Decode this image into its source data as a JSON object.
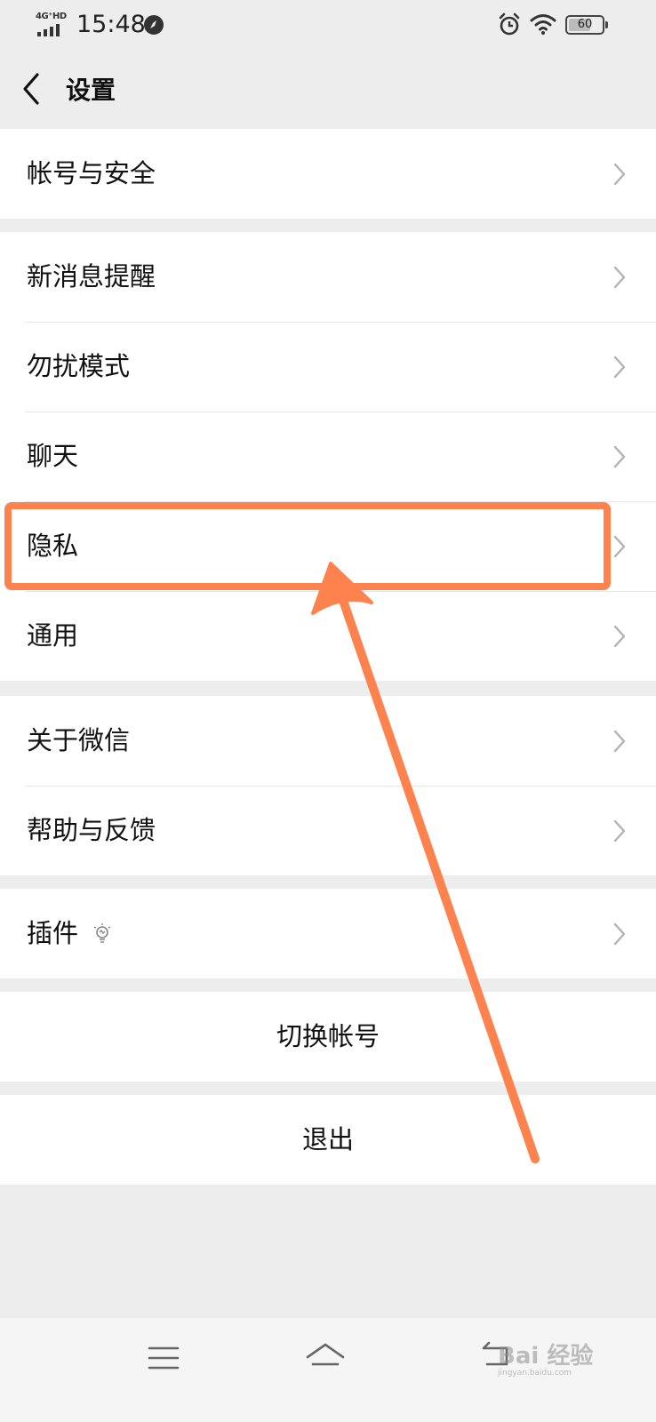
{
  "status_bar": {
    "network": "4G⁺HD",
    "time": "15:48",
    "battery": "60",
    "battery_level": 0.6
  },
  "header": {
    "back_icon": "chevron-left-icon",
    "title": "设置"
  },
  "groups": [
    {
      "items": [
        {
          "label": "帐号与安全"
        }
      ]
    },
    {
      "items": [
        {
          "label": "新消息提醒"
        },
        {
          "label": "勿扰模式"
        },
        {
          "label": "聊天"
        },
        {
          "label": "隐私"
        },
        {
          "label": "通用"
        }
      ]
    },
    {
      "items": [
        {
          "label": "关于微信"
        },
        {
          "label": "帮助与反馈"
        }
      ]
    },
    {
      "items": [
        {
          "label": "插件",
          "icon": "bulb-icon"
        }
      ]
    }
  ],
  "actions": {
    "switch_account": "切换帐号",
    "logout": "退出"
  },
  "annotation": {
    "highlighted_item": "隐私",
    "color": "#fe824e"
  },
  "bottom_nav": {
    "icons": [
      "menu-icon",
      "home-icon",
      "back-icon"
    ]
  },
  "watermark": {
    "text": "Bai 经验",
    "url": "jingyan.baidu.com"
  }
}
